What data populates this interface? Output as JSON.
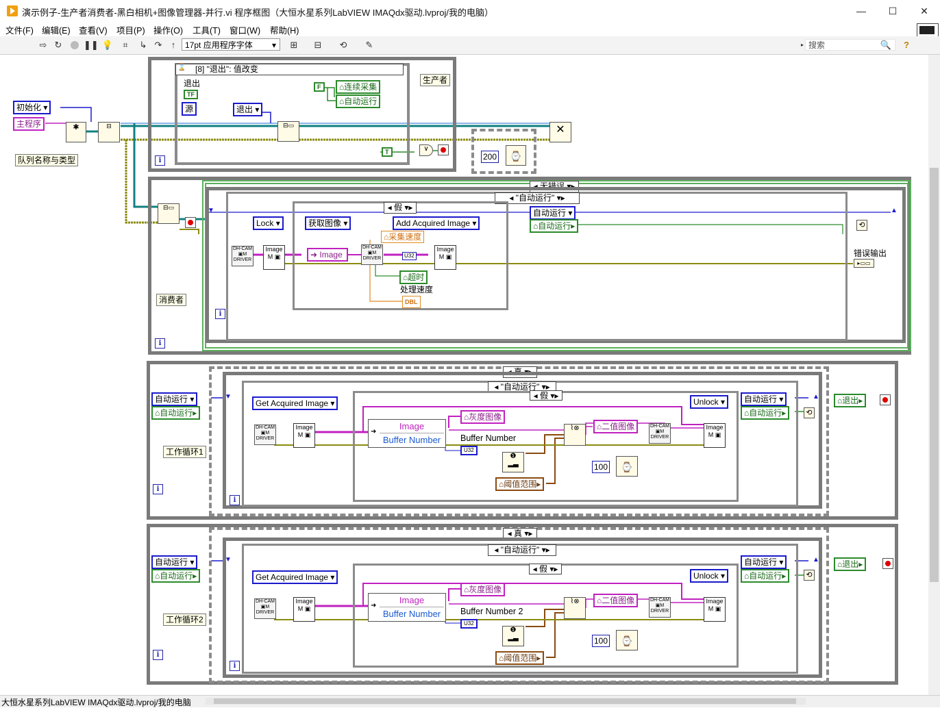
{
  "window": {
    "title": "演示例子-生产者消费者-黑白相机+图像管理器-并行.vi 程序框图（大恒水星系列LabVIEW IMAQdx驱动.lvproj/我的电脑）",
    "minimize": "—",
    "maximize": "☐",
    "close": "✕"
  },
  "menu": [
    "文件(F)",
    "编辑(E)",
    "查看(V)",
    "项目(P)",
    "操作(O)",
    "工具(T)",
    "窗口(W)",
    "帮助(H)"
  ],
  "toolbar": {
    "font": "17pt 应用程序字体",
    "search_placeholder": "搜索",
    "help": "?"
  },
  "producer": {
    "event_selector": "[8] \"退出\": 值改变",
    "exit_label": "退出",
    "tf": "TF",
    "source": "源",
    "false_const": "F",
    "cont_acq": "连续采集",
    "auto_run": "自动运行",
    "exit_enum": "退出",
    "true_const": "T",
    "label": "生产者",
    "wait_ms": "200"
  },
  "init": {
    "init_enum": "初始化",
    "main_prog": "主程序",
    "queue_label": "队列名称与类型"
  },
  "consumer": {
    "error_case": "无错误",
    "case_selector": "\"自动运行\"",
    "bool_case": "假",
    "lock": "Lock",
    "get_image": "获取图像",
    "add_acquired": "Add Acquired Image",
    "image": "Image",
    "acq_speed": "采集速度",
    "timeout": "超时",
    "proc_speed": "处理速度",
    "dbl": "DBL",
    "u32": "U32",
    "auto_run_enum": "自动运行",
    "auto_run_ind": "自动运行",
    "error_out": "错误输出",
    "label": "消费者"
  },
  "work1": {
    "case_true": "真",
    "case_selector": "\"自动运行\"",
    "bool_case": "假",
    "auto_run_enum": "自动运行",
    "auto_run_ind": "自动运行",
    "get_acquired": "Get Acquired Image",
    "image": "Image",
    "buffer_number": "Buffer Number",
    "gray_image": "灰度图像",
    "binary_image": "二值图像",
    "buffer_label": "Buffer Number",
    "u32": "U32",
    "threshold": "阈值范围",
    "unlock": "Unlock",
    "auto_run_enum2": "自动运行",
    "auto_run_ind2": "自动运行",
    "wait_ms": "100",
    "exit": "退出",
    "label": "工作循环1"
  },
  "work2": {
    "case_true": "真",
    "case_selector": "\"自动运行\"",
    "bool_case": "假",
    "auto_run_enum": "自动运行",
    "auto_run_ind": "自动运行",
    "get_acquired": "Get Acquired Image",
    "image": "Image",
    "buffer_number": "Buffer Number",
    "gray_image": "灰度图像",
    "binary_image": "二值图像",
    "buffer_label": "Buffer Number 2",
    "u32": "U32",
    "threshold": "阈值范围",
    "unlock": "Unlock",
    "auto_run_enum2": "自动运行",
    "auto_run_ind2": "自动运行",
    "wait_ms": "100",
    "exit": "退出",
    "label": "工作循环2"
  },
  "status": {
    "path": "大恒水星系列LabVIEW IMAQdx驱动.lvproj/我的电脑"
  },
  "colors": {
    "frame": "#7a7a7a",
    "enum_blue": "#1a1acc",
    "bool_green": "#2a8a2a",
    "image_pink": "#c020c0",
    "error_olive": "#8a8a10",
    "refnum_teal": "#108080"
  }
}
